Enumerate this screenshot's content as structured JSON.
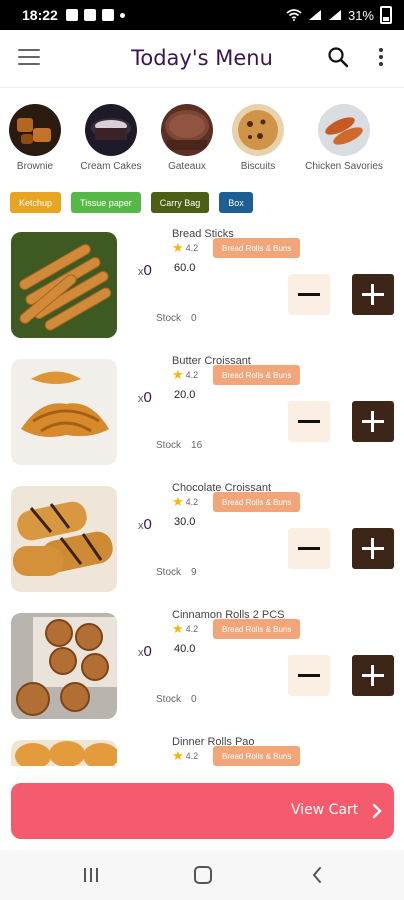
{
  "status_bar": {
    "time": "18:22",
    "battery": "31%"
  },
  "header": {
    "title": "Today's Menu",
    "menu_icon": "hamburger-icon",
    "search_icon": "search-icon",
    "more_icon": "kebab-menu-icon"
  },
  "categories": [
    {
      "label": "Brownie",
      "color": "#7a4214"
    },
    {
      "label": "Cream Cakes",
      "color": "#2a2030"
    },
    {
      "label": "Gateaux",
      "color": "#6b3a2a"
    },
    {
      "label": "Biscuits",
      "color": "#c9893e"
    },
    {
      "label": "Chicken Savories",
      "color": "#c4592a"
    }
  ],
  "chips": [
    {
      "label": "Ketchup",
      "color": "#e8a521"
    },
    {
      "label": "Tissue paper",
      "color": "#56b847"
    },
    {
      "label": "Carry Bag",
      "color": "#4b5e13"
    },
    {
      "label": "Box",
      "color": "#1d5e94"
    }
  ],
  "products": [
    {
      "name": "Bread Sticks",
      "rating": "4.2",
      "tag": "Bread Rolls & Buns",
      "price": "60.0",
      "qty_prefix": "x",
      "qty": "0",
      "stock_label": "Stock",
      "stock": "0"
    },
    {
      "name": "Butter Croissant",
      "rating": "4.2",
      "tag": "Bread Rolls & Buns",
      "price": "20.0",
      "qty_prefix": "x",
      "qty": "0",
      "stock_label": "Stock",
      "stock": "16"
    },
    {
      "name": "Chocolate Croissant",
      "rating": "4.2",
      "tag": "Bread Rolls & Buns",
      "price": "30.0",
      "qty_prefix": "x",
      "qty": "0",
      "stock_label": "Stock",
      "stock": "9"
    },
    {
      "name": "Cinnamon Rolls 2 PCS",
      "rating": "4.2",
      "tag": "Bread Rolls & Buns",
      "price": "40.0",
      "qty_prefix": "x",
      "qty": "0",
      "stock_label": "Stock",
      "stock": "0"
    },
    {
      "name": "Dinner Rolls Pao",
      "rating": "4.2",
      "tag": "Bread Rolls & Buns"
    }
  ],
  "cart": {
    "label": "View Cart",
    "color": "#f45b6c"
  },
  "nav": {
    "recents_icon": "recents-icon",
    "home_icon": "home-icon",
    "back_icon": "back-icon"
  }
}
